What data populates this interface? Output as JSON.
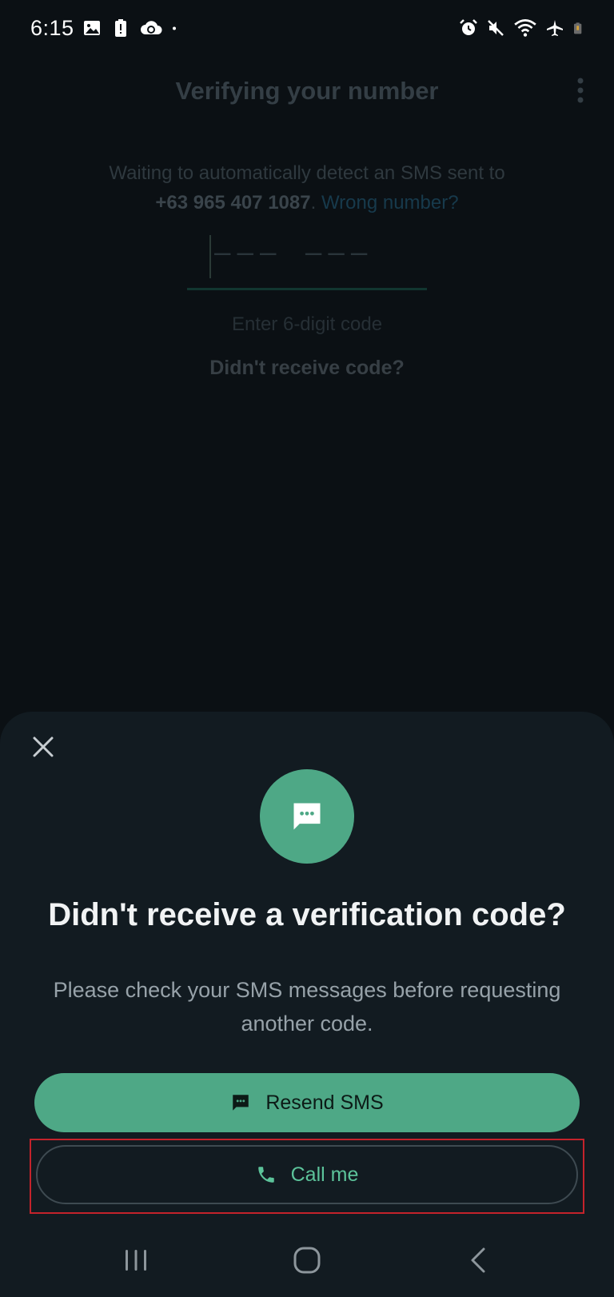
{
  "status_bar": {
    "time": "6:15",
    "left_icons": [
      "gallery-icon",
      "battery-alert-icon",
      "cloud-sync-icon",
      "dot-icon"
    ],
    "right_icons": [
      "alarm-icon",
      "mute-icon",
      "wifi-icon",
      "airplane-icon",
      "battery-low-icon"
    ]
  },
  "background_page": {
    "title": "Verifying your number",
    "waiting_text": "Waiting to automatically detect an SMS sent to",
    "phone_number": "+63 965 407 1087",
    "period": ".",
    "wrong_number_link": "Wrong number?",
    "code_placeholder": "––– –––",
    "enter_code_hint": "Enter 6-digit code",
    "didnt_receive_link": "Didn't receive code?"
  },
  "sheet": {
    "title": "Didn't receive a verification code?",
    "body": "Please check your SMS messages before requesting another code.",
    "resend_button": "Resend SMS",
    "call_button": "Call me"
  },
  "colors": {
    "accent_green": "#4ea886",
    "call_text_green": "#5cc39a",
    "sheet_bg": "#121b21",
    "page_bg": "#0b1014",
    "highlight_red": "#c4232b"
  }
}
